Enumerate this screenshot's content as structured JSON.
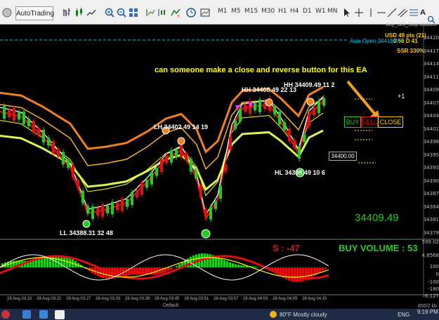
{
  "toolbar": {
    "autotrading_label": "AutoTrading",
    "timeframes": [
      "M1",
      "M5",
      "M15",
      "M30",
      "H1",
      "H4",
      "D1",
      "W1",
      "MN"
    ]
  },
  "chart": {
    "ea_label": "Buy_Sell_Stop Buttons",
    "usd_pts": "USD 49 pts (21)",
    "usd_sub": "0 56 D 41",
    "asia_open": "Asia Open 34419.49",
    "ssr": "SSR 330%",
    "headline": "can someone make a close and reverse button for this EA",
    "plus_one": "+1",
    "buy_label": "BUY",
    "sell_label": "SELL",
    "close_label": "CLOSE",
    "price_box": "34400.00",
    "current_price": "34409.49",
    "labels": {
      "hh1": "HH 34409.49 11   2",
      "hh2": "HH 34408.49 22   13",
      "lh": "LH 34402.49 14   19",
      "hl": "HL 34398.49 10   6",
      "ll": "LL 34388.31 32   48"
    },
    "price_axis": [
      "34420",
      "34417",
      "34414",
      "34411",
      "34409",
      "34407",
      "34404",
      "34401",
      "34398",
      "34395",
      "34393",
      "34390",
      "34387",
      "34384",
      "34381",
      "34379"
    ],
    "indicator_axis": [
      "599.02",
      "4.8568",
      "100",
      "0",
      "-100",
      "-180",
      "-6.127"
    ],
    "s_value": "S : -47",
    "buy_volume": "BUY VOLUME : 53",
    "time_labels": [
      "28 Aug 03:15",
      "28 Aug 03:21",
      "28 Aug 03:27",
      "28 Aug 03:33",
      "28 Aug 03:39",
      "28 Aug 03:45",
      "28 Aug 03:51",
      "28 Aug 03:57",
      "28 Aug 04:03",
      "28 Aug 04:09",
      "28 Aug 04:15"
    ],
    "tab_default": "Default",
    "bar_info": "850/2 kb"
  },
  "taskbar": {
    "weather": "80°F  Mostly cloudy",
    "lang": "ENG",
    "time": "9:19 PM"
  },
  "colors": {
    "green": "#22cc22",
    "red": "#e01010",
    "yellow": "#ffff00",
    "orange": "#f08020",
    "lime": "#d7f35a",
    "cyan": "#00ccff"
  }
}
